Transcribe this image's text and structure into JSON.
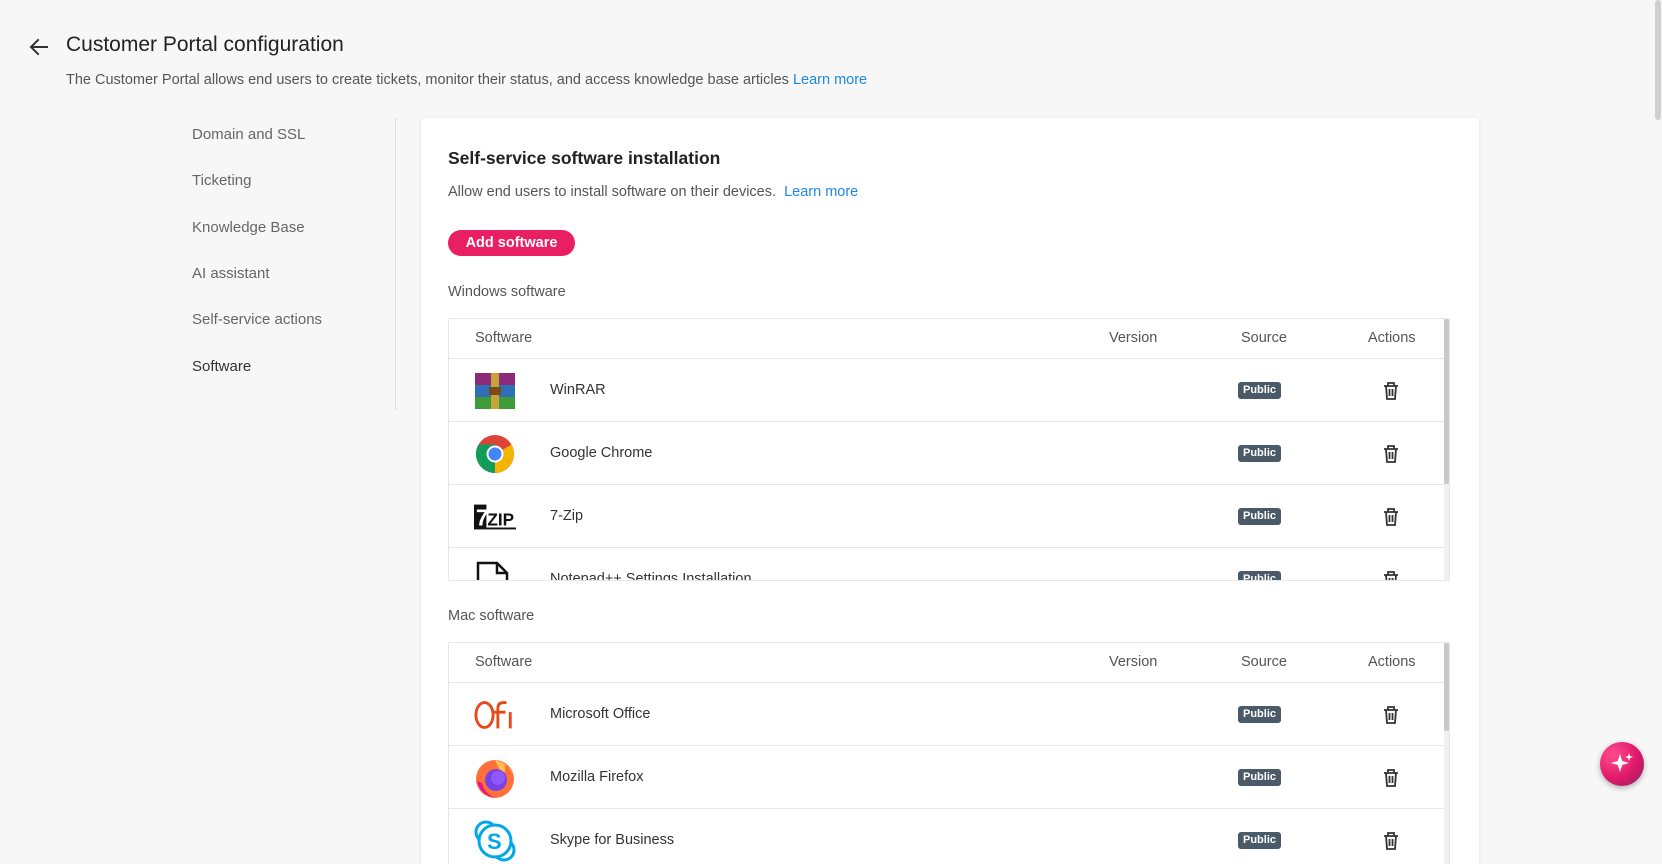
{
  "header": {
    "title": "Customer Portal configuration",
    "description": "The Customer Portal allows end users to create tickets, monitor their status, and access knowledge base articles",
    "learn_more": "Learn more"
  },
  "sidebar": {
    "items": [
      {
        "label": "Domain and SSL"
      },
      {
        "label": "Ticketing"
      },
      {
        "label": "Knowledge Base"
      },
      {
        "label": "AI assistant"
      },
      {
        "label": "Self-service actions"
      },
      {
        "label": "Software",
        "active": true
      }
    ]
  },
  "main": {
    "title": "Self-service software installation",
    "description": "Allow end users to install software on their devices.",
    "learn_more": "Learn more",
    "add_button": "Add software",
    "columns": {
      "software": "Software",
      "version": "Version",
      "source": "Source",
      "actions": "Actions"
    },
    "windows": {
      "label": "Windows software",
      "rows": [
        {
          "name": "WinRAR",
          "version": "",
          "source": "Public",
          "icon": "winrar-icon"
        },
        {
          "name": "Google Chrome",
          "version": "",
          "source": "Public",
          "icon": "chrome-icon"
        },
        {
          "name": "7-Zip",
          "version": "",
          "source": "Public",
          "icon": "7zip-icon"
        },
        {
          "name": "Notepad++ Settings Installation",
          "version": "",
          "source": "Public",
          "icon": "file-icon"
        }
      ]
    },
    "mac": {
      "label": "Mac software",
      "rows": [
        {
          "name": "Microsoft Office",
          "version": "",
          "source": "Public",
          "icon": "office-icon"
        },
        {
          "name": "Mozilla Firefox",
          "version": "",
          "source": "Public",
          "icon": "firefox-icon"
        },
        {
          "name": "Skype for Business",
          "version": "",
          "source": "Public",
          "icon": "skype-icon"
        }
      ]
    }
  },
  "colors": {
    "accent": "#e91e63",
    "link": "#1e88e5",
    "badge": "#4a5a68"
  }
}
